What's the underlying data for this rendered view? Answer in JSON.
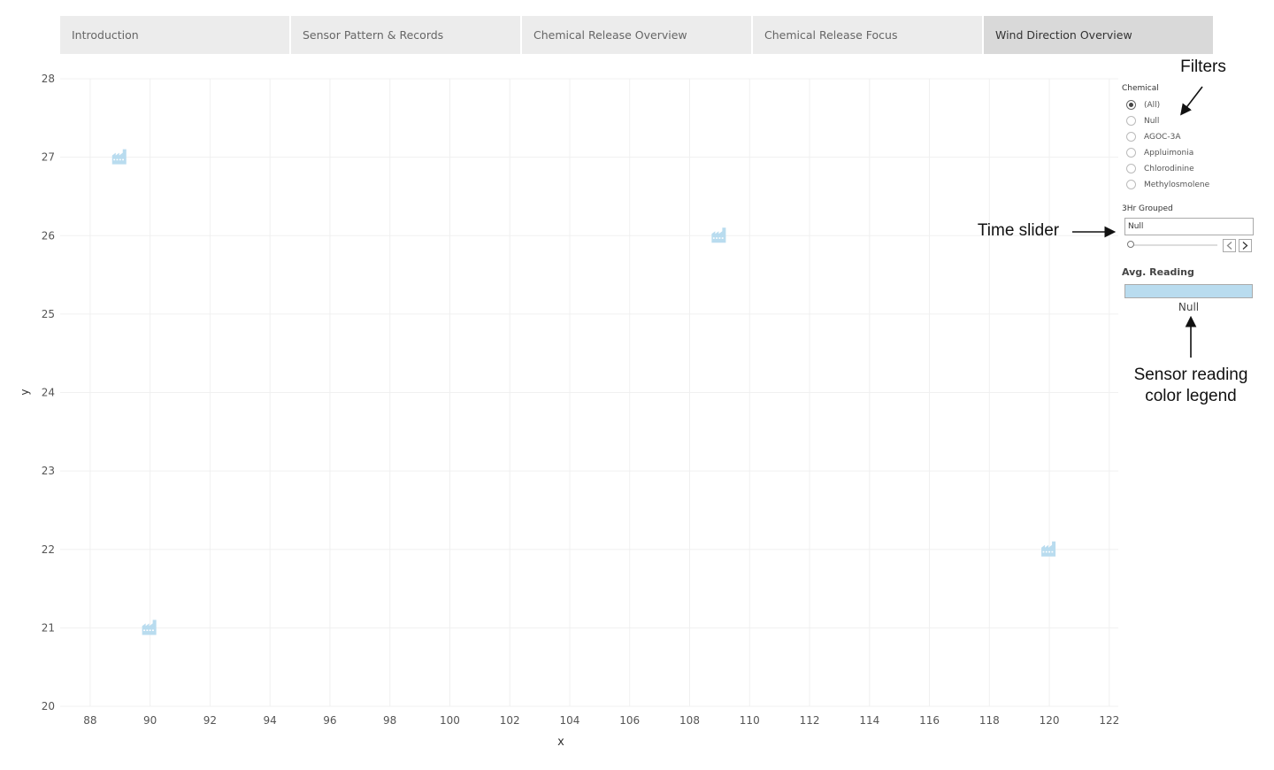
{
  "tabs": [
    {
      "label": "Introduction",
      "active": false
    },
    {
      "label": "Sensor Pattern & Records",
      "active": false
    },
    {
      "label": "Chemical Release Overview",
      "active": false
    },
    {
      "label": "Chemical Release Focus",
      "active": false
    },
    {
      "label": "Wind Direction Overview",
      "active": true
    }
  ],
  "filters": {
    "chemical": {
      "title": "Chemical",
      "options": [
        "(All)",
        "Null",
        "AGOC-3A",
        "Appluimonia",
        "Chlorodinine",
        "Methylosmolene"
      ],
      "selected": "(All)"
    },
    "time": {
      "title": "3Hr Grouped",
      "value": "Null",
      "slider_position": 0
    },
    "legend": {
      "title": "Avg. Reading",
      "value": "Null",
      "color": "#b9dcef"
    }
  },
  "annotations": {
    "filters": "Filters",
    "time_slider": "Time slider",
    "legend_line1": "Sensor reading",
    "legend_line2": "color legend"
  },
  "chart_data": {
    "type": "scatter",
    "xlabel": "x",
    "ylabel": "y",
    "xlim": [
      87,
      122.3
    ],
    "ylim": [
      20,
      28
    ],
    "x_ticks": [
      88,
      90,
      92,
      94,
      96,
      98,
      100,
      102,
      104,
      106,
      108,
      110,
      112,
      114,
      116,
      118,
      120,
      122
    ],
    "y_ticks": [
      20,
      21,
      22,
      23,
      24,
      25,
      26,
      27,
      28
    ],
    "grid": true,
    "marker": "factory-icon",
    "marker_color": "#b9dcef",
    "points": [
      {
        "x": 89,
        "y": 27
      },
      {
        "x": 109,
        "y": 26
      },
      {
        "x": 120,
        "y": 22
      },
      {
        "x": 90,
        "y": 21
      }
    ]
  }
}
